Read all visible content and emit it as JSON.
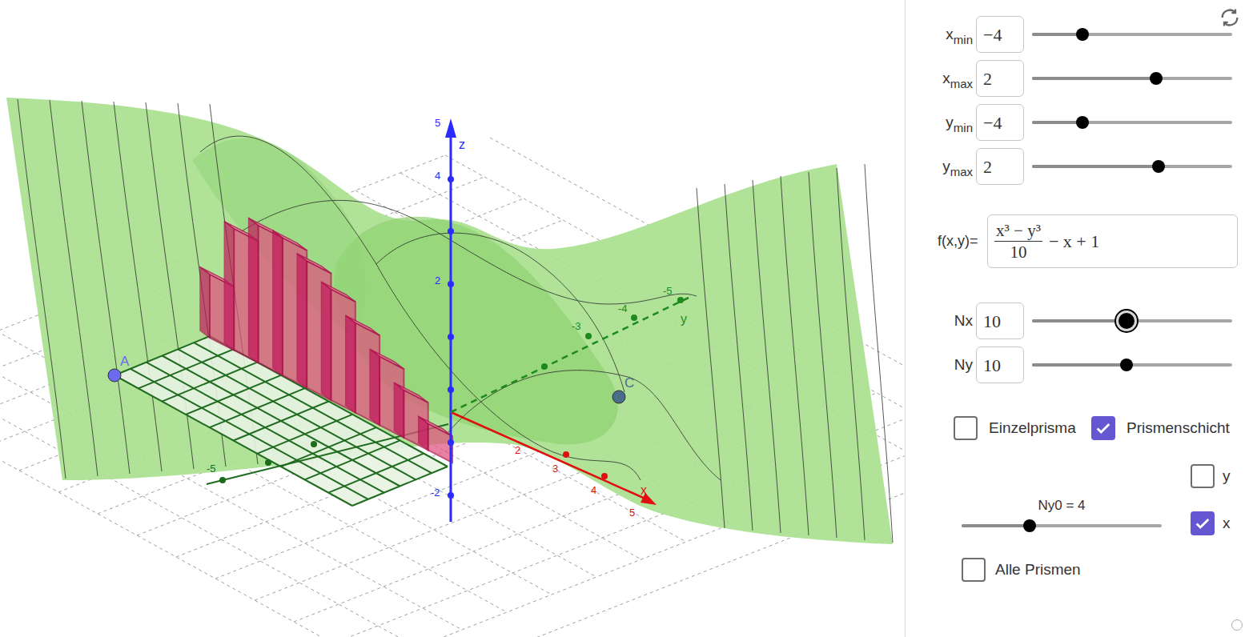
{
  "graphics": {
    "axisLabels": {
      "z": "z",
      "x": "x",
      "y": "y"
    },
    "points": [
      {
        "label": "A"
      },
      {
        "label": "C"
      }
    ],
    "zTicks": [
      "5",
      "4",
      "2",
      "-2"
    ],
    "xTicks": [
      "2",
      "3",
      "4",
      "5"
    ],
    "yTicks": [
      "-3",
      "-4",
      "-5"
    ],
    "floorTicks": [
      "-5"
    ],
    "prisms": {
      "heights": [
        1.2,
        2.3,
        2.6,
        2.6,
        2.4,
        2.1,
        1.7,
        1.3,
        0.9,
        0.5
      ]
    }
  },
  "sliders": [
    {
      "label": "x",
      "sub": "min",
      "value": "−4",
      "level": 0.25
    },
    {
      "label": "x",
      "sub": "max",
      "value": "2",
      "level": 0.62
    },
    {
      "label": "y",
      "sub": "min",
      "value": "−4",
      "level": 0.25
    },
    {
      "label": "y",
      "sub": "max",
      "value": "2",
      "level": 0.63
    }
  ],
  "function": {
    "label": "f(x,y)=",
    "numerator": "x³ − y³",
    "denominator": "10",
    "rest": "− x + 1"
  },
  "counts": [
    {
      "label": "Nx",
      "value": "10",
      "level": 0.47,
      "focused": true
    },
    {
      "label": "Ny",
      "value": "10",
      "level": 0.47,
      "focused": false
    }
  ],
  "options": [
    {
      "label": "Einzelprisma",
      "checked": false
    },
    {
      "label": "Prismenschicht",
      "checked": true
    }
  ],
  "axisChoice": [
    {
      "label": "y",
      "checked": false
    },
    {
      "label": "x",
      "checked": true
    }
  ],
  "layer": {
    "label": "Ny0 = 4",
    "level": 0.34
  },
  "allPrisms": {
    "label": "Alle Prismen",
    "checked": false
  }
}
